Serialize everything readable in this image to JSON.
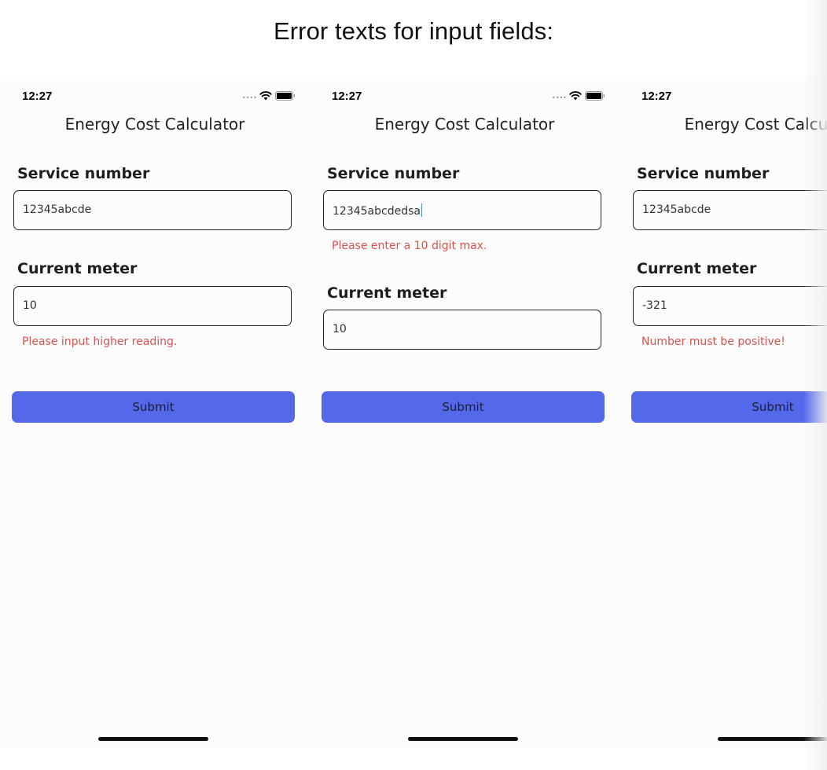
{
  "heading": "Error texts for input fields:",
  "colors": {
    "accent": "#5468ea",
    "error": "#d9534f"
  },
  "screens": [
    {
      "time": "12:27",
      "app_title": "Energy Cost Calculator",
      "service_label": "Service number",
      "service_value": "12345abcde",
      "service_error": "",
      "meter_label": "Current meter",
      "meter_value": "10",
      "meter_error": "Please input higher reading.",
      "submit_label": "Submit"
    },
    {
      "time": "12:27",
      "app_title": "Energy Cost Calculator",
      "service_label": "Service number",
      "service_value": "12345abcdedsa",
      "service_error": "Please enter a 10 digit max.",
      "meter_label": "Current meter",
      "meter_value": "10",
      "meter_error": "",
      "submit_label": "Submit"
    },
    {
      "time": "12:27",
      "app_title": "Energy Cost Calculator",
      "service_label": "Service number",
      "service_value": "12345abcde",
      "service_error": "",
      "meter_label": "Current meter",
      "meter_value": "-321",
      "meter_error": "Number must be positive!",
      "submit_label": "Submit"
    }
  ],
  "icons": [
    "signal-dots-icon",
    "wifi-icon",
    "battery-icon"
  ]
}
